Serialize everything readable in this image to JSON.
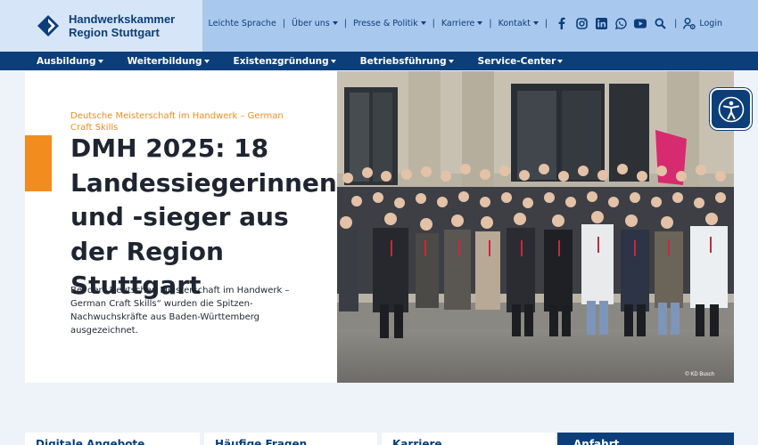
{
  "brand": {
    "line1": "Handwerkskammer",
    "line2": "Region Stuttgart"
  },
  "topnav": {
    "items": [
      {
        "label": "Leichte Sprache",
        "dropdown": false
      },
      {
        "label": "Über uns",
        "dropdown": true
      },
      {
        "label": "Presse & Politik",
        "dropdown": true
      },
      {
        "label": "Karriere",
        "dropdown": true
      },
      {
        "label": "Kontakt",
        "dropdown": true
      }
    ],
    "social_icons": [
      "facebook-icon",
      "instagram-icon",
      "linkedin-icon",
      "whatsapp-icon",
      "youtube-icon"
    ],
    "search_icon": "search-icon",
    "login_label": "Login"
  },
  "mainnav": {
    "items": [
      "Ausbildung",
      "Weiterbildung",
      "Existenzgründung",
      "Betriebsführung",
      "Service-Center"
    ]
  },
  "hero": {
    "kicker": "Deutsche Meisterschaft im Handwerk – German Craft Skills",
    "headline": "DMH 2025: 18 Landessiegerinnen und -sieger aus der Region Stuttgart",
    "teaser": "Bei der „Deutschen Meisterschaft im Handwerk – German Craft Skills“ wurden die Spitzen-Nachwuchskräfte aus Baden-Württemberg ausgezeichnet.",
    "photo_credit": "© KD Busch"
  },
  "cards": [
    "Digitale Angebote",
    "Häufige Fragen",
    "Karriere",
    "Anfahrt"
  ],
  "colors": {
    "primary": "#0c3e7a",
    "accent": "#f28c1f",
    "header_bg": "#a9c8ee",
    "logo_bg": "#d6e5f8",
    "page_bg": "#eef2f9"
  }
}
